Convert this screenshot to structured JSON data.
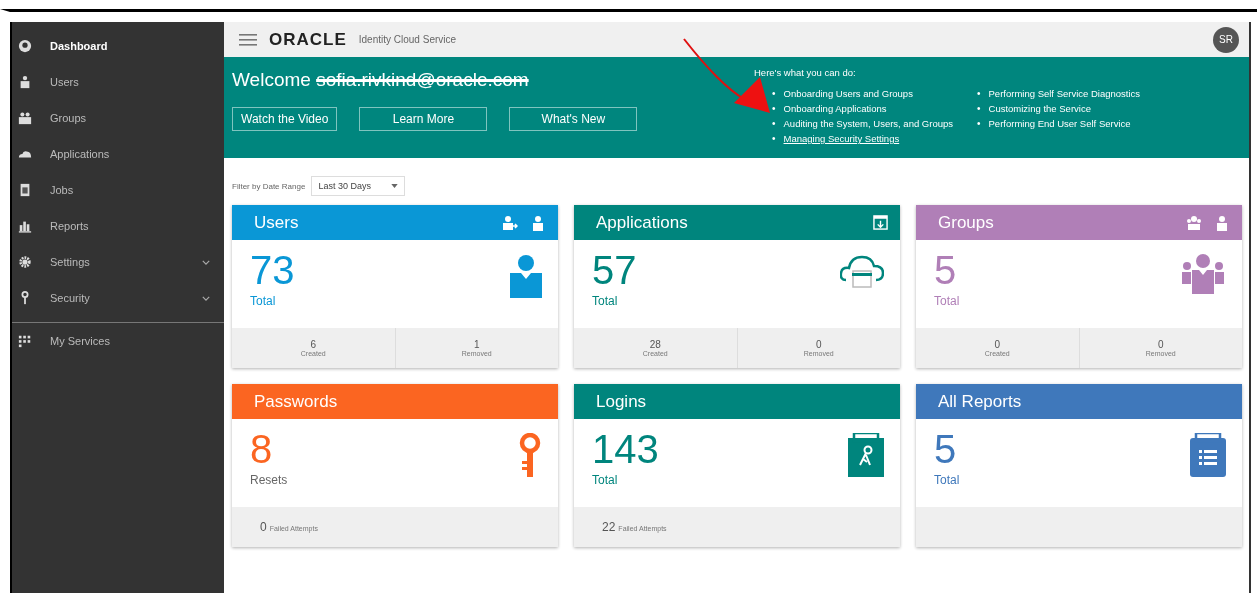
{
  "sidebar": {
    "items": [
      {
        "label": "Dashboard",
        "selected": true,
        "has_submenu": false,
        "separated": false
      },
      {
        "label": "Users",
        "selected": false,
        "has_submenu": false,
        "separated": false
      },
      {
        "label": "Groups",
        "selected": false,
        "has_submenu": false,
        "separated": false
      },
      {
        "label": "Applications",
        "selected": false,
        "has_submenu": false,
        "separated": false
      },
      {
        "label": "Jobs",
        "selected": false,
        "has_submenu": false,
        "separated": false
      },
      {
        "label": "Reports",
        "selected": false,
        "has_submenu": false,
        "separated": false
      },
      {
        "label": "Settings",
        "selected": false,
        "has_submenu": true,
        "separated": false
      },
      {
        "label": "Security",
        "selected": false,
        "has_submenu": true,
        "separated": false
      },
      {
        "label": "My Services",
        "selected": false,
        "has_submenu": false,
        "separated": true
      }
    ]
  },
  "header": {
    "brand": "ORACLE",
    "product": "Identity Cloud Service",
    "avatar": "SR"
  },
  "banner": {
    "greeting": "Welcome",
    "email": "sofia.rivkind@oracle.com",
    "email_redacted": true,
    "buttons": [
      "Watch the Video",
      "Learn More",
      "What's New"
    ],
    "intro": "Here's what you can do:",
    "bullet": "•",
    "links_left": [
      {
        "label": "Onboarding Users and Groups",
        "underlined": false
      },
      {
        "label": "Onboarding Applications",
        "underlined": false
      },
      {
        "label": "Auditing the System, Users, and Groups",
        "underlined": false
      },
      {
        "label": "Managing Security Settings",
        "underlined": true
      }
    ],
    "links_right": [
      {
        "label": "Performing Self Service Diagnostics",
        "underlined": false
      },
      {
        "label": "Customizing the Service",
        "underlined": false
      },
      {
        "label": "Performing End User Self Service",
        "underlined": false
      }
    ]
  },
  "filter": {
    "label": "Filter by Date Range",
    "value": "Last 30 Days"
  },
  "cards": [
    {
      "title": "Users",
      "color": "#0a97d6",
      "value": "73",
      "value_label": "Total",
      "kind": "stats",
      "stats": [
        {
          "value": "6",
          "label": "Created"
        },
        {
          "value": "1",
          "label": "Removed"
        }
      ]
    },
    {
      "title": "Applications",
      "color": "#00857d",
      "value": "57",
      "value_label": "Total",
      "kind": "stats",
      "stats": [
        {
          "value": "28",
          "label": "Created"
        },
        {
          "value": "0",
          "label": "Removed"
        }
      ]
    },
    {
      "title": "Groups",
      "color": "#b07fb7",
      "value": "5",
      "value_label": "Total",
      "kind": "stats",
      "stats": [
        {
          "value": "0",
          "label": "Created"
        },
        {
          "value": "0",
          "label": "Removed"
        }
      ]
    },
    {
      "title": "Passwords",
      "color": "#fb6521",
      "value": "8",
      "value_label": "Resets",
      "kind": "note",
      "note": {
        "value": "0",
        "label": "Failed Attempts"
      }
    },
    {
      "title": "Logins",
      "color": "#00857d",
      "value": "143",
      "value_label": "Total",
      "kind": "note",
      "note": {
        "value": "22",
        "label": "Failed Attempts"
      }
    },
    {
      "title": "All Reports",
      "color": "#3f78bb",
      "value": "5",
      "value_label": "Total",
      "kind": "empty"
    }
  ]
}
